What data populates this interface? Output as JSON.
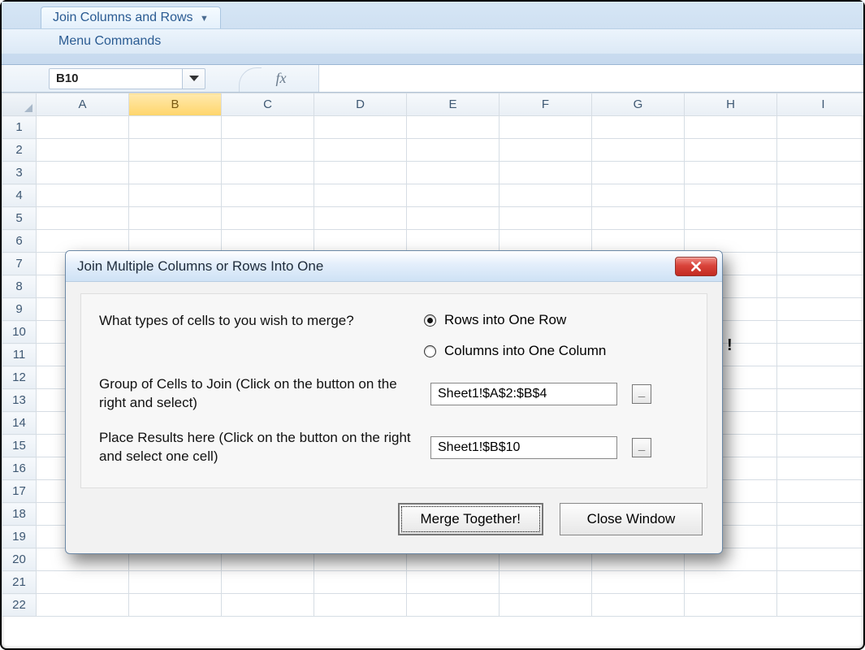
{
  "ribbon": {
    "tab_label": "Join Columns and Rows",
    "sub_label": "Menu Commands"
  },
  "namebox": {
    "value": "B10"
  },
  "fx": {
    "label": "fx"
  },
  "columns": [
    "A",
    "B",
    "C",
    "D",
    "E",
    "F",
    "G",
    "H",
    "I"
  ],
  "selected_col_index": 1,
  "rows": [
    "1",
    "2",
    "3",
    "4",
    "5",
    "6",
    "7",
    "8",
    "9",
    "10",
    "11",
    "12",
    "13",
    "14",
    "15",
    "16",
    "17",
    "18",
    "19",
    "20",
    "21",
    "22"
  ],
  "selected_row_index": 9,
  "overflow_hint": "!",
  "dialog": {
    "title": "Join Multiple Columns or Rows Into One",
    "merge_question": "What types of cells to you wish to merge?",
    "radio_rows": "Rows into One Row",
    "radio_cols": "Columns into One Column",
    "radio_selected": "rows",
    "group_label": "Group of Cells to Join (Click on the button on the right and select)",
    "group_value": "Sheet1!$A$2:$B$4",
    "result_label": "Place Results here (Click on the button on the right and select one cell)",
    "result_value": "Sheet1!$B$10",
    "range_btn": "_",
    "merge_btn": "Merge Together!",
    "close_btn": "Close Window"
  }
}
